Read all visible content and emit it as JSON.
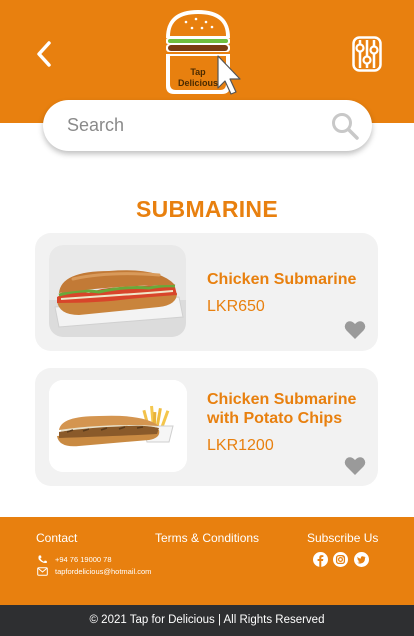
{
  "header": {
    "logo_text_line1": "Tap",
    "logo_text_line2": "Delicious",
    "back_icon": "chevron-left-icon",
    "filter_icon": "sliders-icon"
  },
  "search": {
    "placeholder": "Search",
    "icon": "search-icon"
  },
  "category": {
    "title": "SUBMARINE"
  },
  "products": [
    {
      "name": "Chicken Submarine",
      "price": "LKR650",
      "image": "submarine-sandwich"
    },
    {
      "name": "Chicken Submarine with Potato Chips",
      "price": "LKR1200",
      "image": "submarine-with-fries"
    }
  ],
  "footer": {
    "contact_label": "Contact",
    "terms_label": "Terms & Conditions",
    "subscribe_label": "Subscribe Us",
    "phone": "+94 76 19000 78",
    "email": "tapfordelicious@hotmail.com",
    "social_icons": [
      "facebook-icon",
      "instagram-icon",
      "twitter-icon"
    ],
    "copyright": "© 2021 Tap for Delicious | All Rights Reserved"
  },
  "colors": {
    "brand": "#E8800F",
    "card_bg": "#f2f2f2",
    "heart": "#9a9a9a",
    "bottom_bar": "#2e2f31"
  }
}
